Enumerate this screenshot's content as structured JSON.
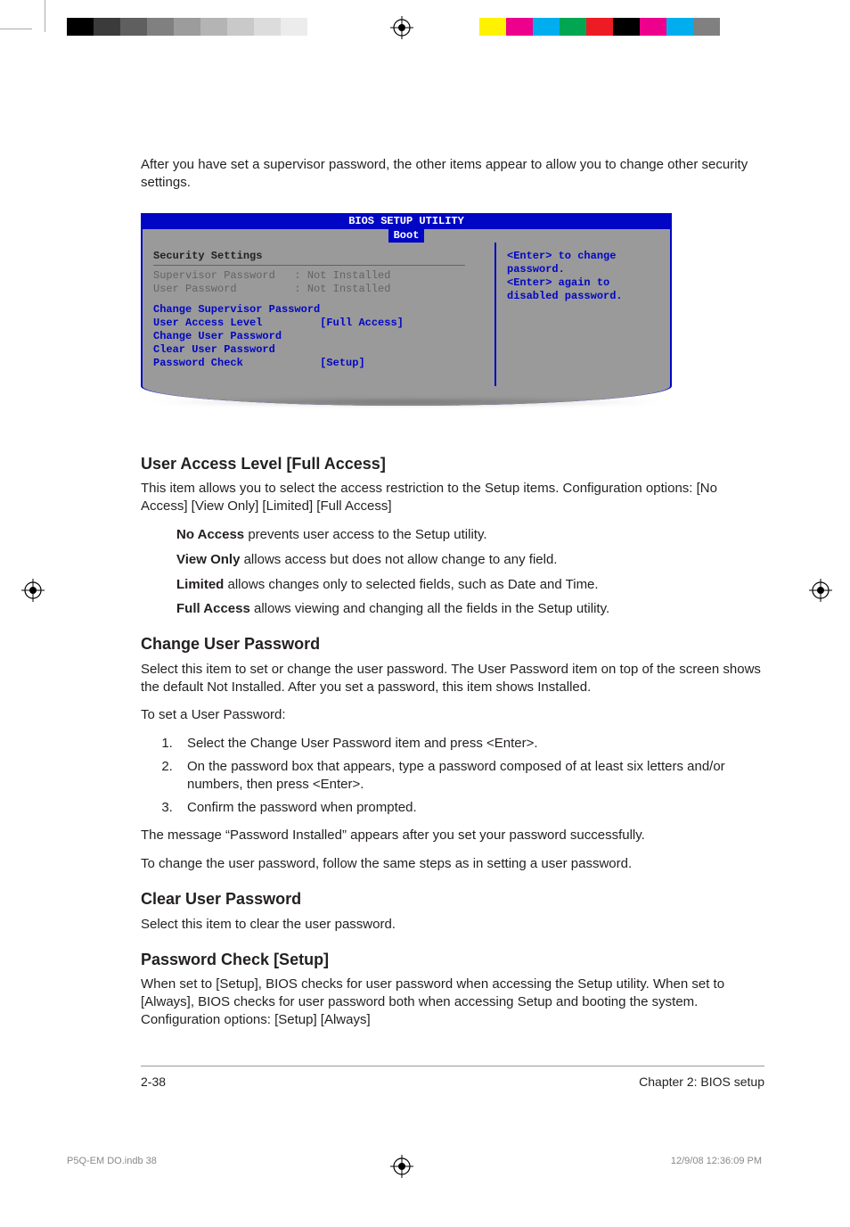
{
  "intro": "After you have set a supervisor password, the other items appear to allow you to change other security settings.",
  "bios": {
    "title": "BIOS SETUP UTILITY",
    "tab": "Boot",
    "section": "Security Settings",
    "rows": {
      "supervisor": "Supervisor Password   : Not Installed",
      "user": "User Password         : Not Installed",
      "change_sup": "Change Supervisor Password",
      "ual": "User Access Level         [Full Access]",
      "change_usr": "Change User Password",
      "clear_usr": "Clear User Password",
      "pwcheck": "Password Check            [Setup]"
    },
    "help": "<Enter> to change password.\n<Enter> again to disabled password."
  },
  "h_ual": "User Access Level [Full Access]",
  "p_ual": "This item allows you to select the access restriction to the Setup items. Configuration options: [No Access] [View Only] [Limited] [Full Access]",
  "opt_na_b": "No Access",
  "opt_na": " prevents user access to the Setup utility.",
  "opt_vo_b": "View Only",
  "opt_vo": " allows access but does not allow change to any field.",
  "opt_li_b": "Limited",
  "opt_li": " allows changes only to selected fields, such as Date and Time.",
  "opt_fa_b": "Full Access",
  "opt_fa": " allows viewing and changing all the fields in the Setup utility.",
  "h_cup": "Change User Password",
  "p_cup": "Select this item to set or change the user password. The User Password item on top of the screen shows the default Not Installed. After you set a password, this item shows Installed.",
  "p_set": "To set a User Password:",
  "steps": {
    "s1": "Select the Change User Password item and press <Enter>.",
    "s2": "On the password box that appears, type a password composed of at least six letters and/or numbers, then press <Enter>.",
    "s3": "Confirm the password when prompted."
  },
  "p_msg": "The message “Password Installed” appears after you set your password successfully.",
  "p_chg": "To change the user password, follow the same steps as in setting a user password.",
  "h_clr": "Clear User Password",
  "p_clr": "Select this item to clear the user password.",
  "h_pwc": "Password Check [Setup]",
  "p_pwc": "When set to [Setup], BIOS checks for user password when accessing the Setup utility. When set to [Always], BIOS checks for user password both when accessing Setup and booting the system. Configuration options: [Setup] [Always]",
  "footer": {
    "page": "2-38",
    "chapter": "Chapter 2: BIOS setup"
  },
  "print": {
    "file": "P5Q-EM DO.indb   38",
    "stamp": "12/9/08   12:36:09 PM"
  },
  "colors": {
    "left": [
      "#000",
      "#3b3b3b",
      "#5f5f5f",
      "#808080",
      "#9c9c9c",
      "#b4b4b4",
      "#c9c9c9",
      "#dcdcdc",
      "#ececec",
      "#fff"
    ],
    "right": [
      "#fff200",
      "#ec008c",
      "#00aeef",
      "#00a651",
      "#ed1c24",
      "#000",
      "#ec008c",
      "#00aeef",
      "#808080"
    ]
  }
}
